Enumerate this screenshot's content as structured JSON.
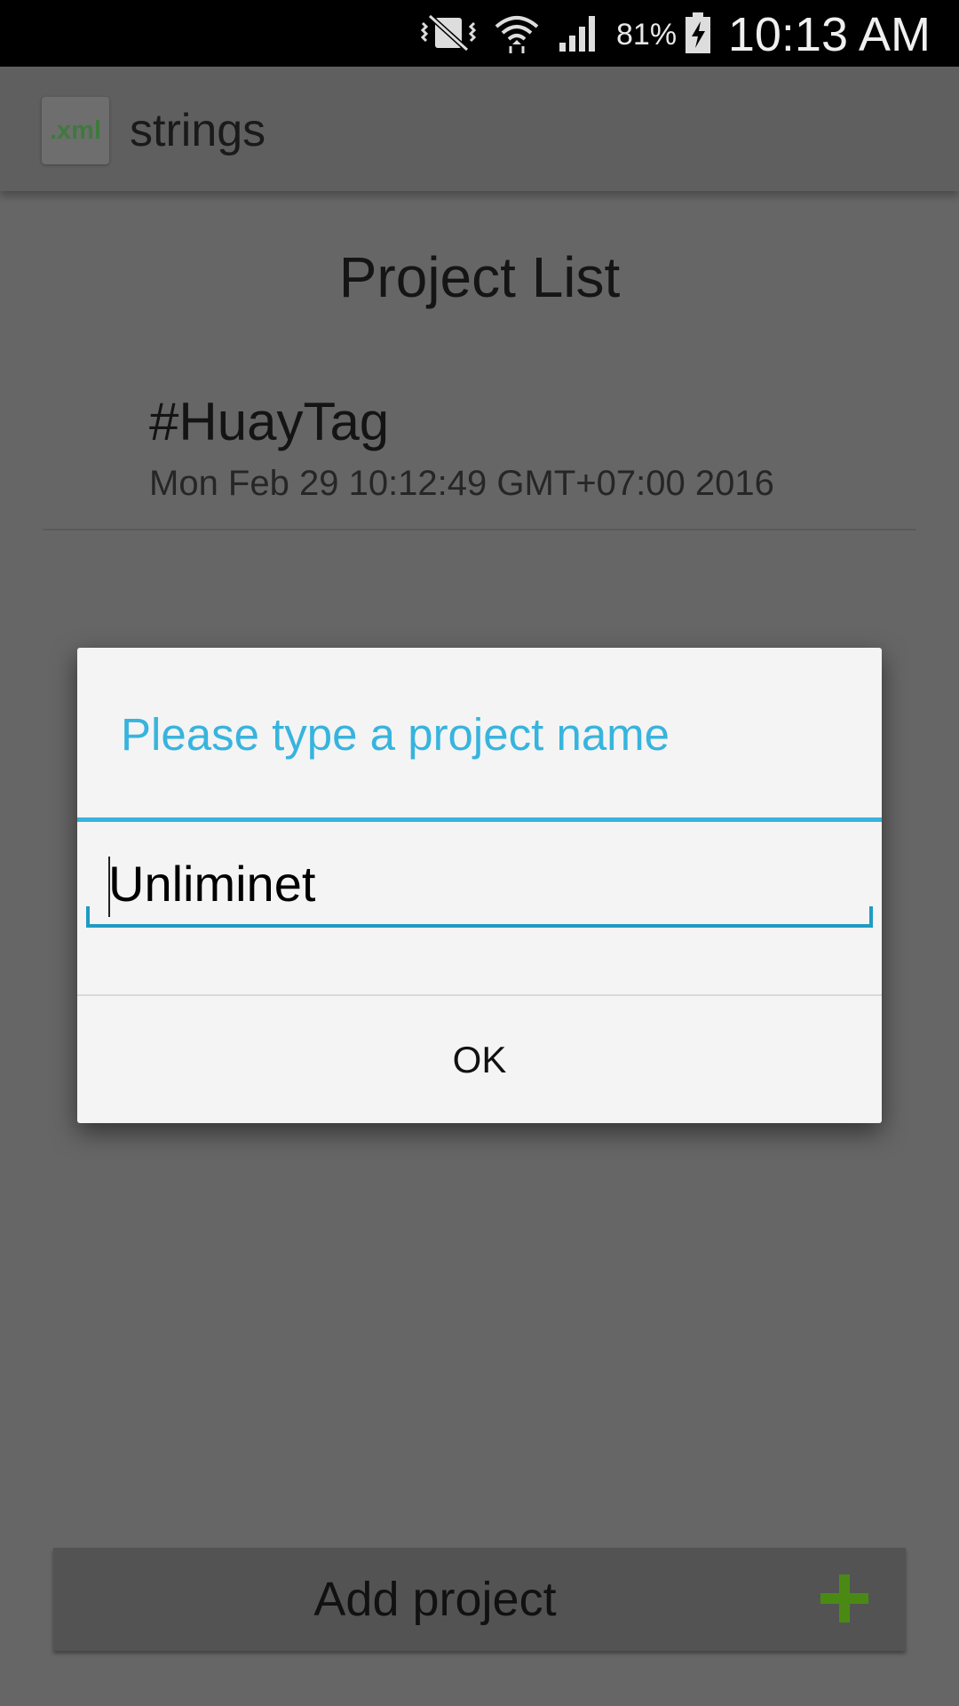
{
  "status_bar": {
    "battery_percent": "81%",
    "time": "10:13 AM",
    "icons": [
      "vibrate-mute-icon",
      "wifi-icon",
      "signal-icon",
      "battery-charging-icon"
    ]
  },
  "app_bar": {
    "logo_text": ".xml",
    "title": "strings"
  },
  "main": {
    "heading": "Project List",
    "projects": [
      {
        "name": "#HuayTag",
        "date": "Mon Feb 29 10:12:49 GMT+07:00 2016"
      }
    ]
  },
  "dialog": {
    "title": "Please type a project name",
    "input_value": "Unliminet",
    "ok_label": "OK"
  },
  "footer": {
    "add_label": "Add project",
    "icon": "plus-icon"
  },
  "colors": {
    "accent": "#37b4de",
    "input_underline": "#1f9bc0",
    "plus_green": "#4a8a14",
    "logo_green": "#3e7a3c"
  }
}
